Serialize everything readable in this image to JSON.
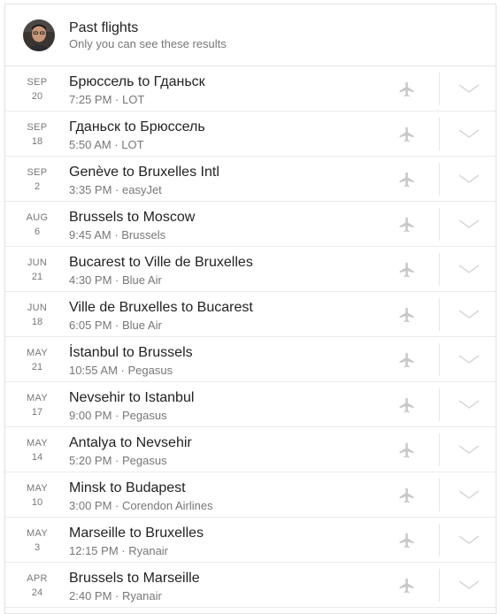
{
  "header": {
    "title": "Past flights",
    "subtitle": "Only you can see these results"
  },
  "icons": {
    "flight": "flight-icon",
    "expand": "chevron-down-icon"
  },
  "colors": {
    "icon": "#c8c8c8",
    "chevron": "#d6d6d6",
    "text_primary": "#222222",
    "text_secondary": "#777777"
  },
  "flights": [
    {
      "month": "SEP",
      "day": "20",
      "route": "Брюссель to Гданьск",
      "time": "7:25 PM",
      "airline": "LOT"
    },
    {
      "month": "SEP",
      "day": "18",
      "route": "Гданьск to Брюссель",
      "time": "5:50 AM",
      "airline": "LOT"
    },
    {
      "month": "SEP",
      "day": "2",
      "route": "Genève to Bruxelles Intl",
      "time": "3:35 PM",
      "airline": "easyJet"
    },
    {
      "month": "AUG",
      "day": "6",
      "route": "Brussels to Moscow",
      "time": "9:45 AM",
      "airline": "Brussels"
    },
    {
      "month": "JUN",
      "day": "21",
      "route": "Bucarest to Ville de Bruxelles",
      "time": "4:30 PM",
      "airline": "Blue Air"
    },
    {
      "month": "JUN",
      "day": "18",
      "route": "Ville de Bruxelles to Bucarest",
      "time": "6:05 PM",
      "airline": "Blue Air"
    },
    {
      "month": "MAY",
      "day": "21",
      "route": "İstanbul to Brussels",
      "time": "10:55 AM",
      "airline": "Pegasus"
    },
    {
      "month": "MAY",
      "day": "17",
      "route": "Nevsehir to Istanbul",
      "time": "9:00 PM",
      "airline": "Pegasus"
    },
    {
      "month": "MAY",
      "day": "14",
      "route": "Antalya to Nevsehir",
      "time": "5:20 PM",
      "airline": "Pegasus"
    },
    {
      "month": "MAY",
      "day": "10",
      "route": "Minsk to Budapest",
      "time": "3:00 PM",
      "airline": "Corendon Airlines"
    },
    {
      "month": "MAY",
      "day": "3",
      "route": "Marseille to Bruxelles",
      "time": "12:15 PM",
      "airline": "Ryanair"
    },
    {
      "month": "APR",
      "day": "24",
      "route": "Brussels to Marseille",
      "time": "2:40 PM",
      "airline": "Ryanair"
    }
  ]
}
